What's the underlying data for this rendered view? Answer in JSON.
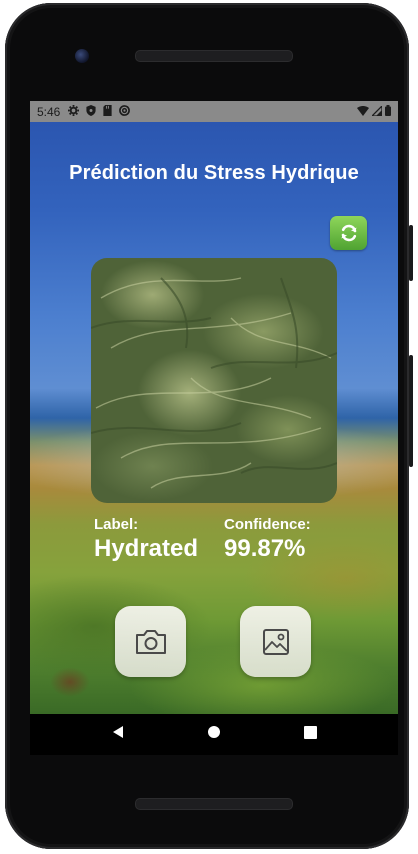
{
  "status_bar": {
    "time": "5:46",
    "left_icons": [
      "gear-icon",
      "shield-icon",
      "sd-card-icon",
      "at-sign-icon"
    ],
    "right_icons": [
      "wifi-icon",
      "signal-icon",
      "battery-icon"
    ]
  },
  "app": {
    "title": "Prédiction du Stress Hydrique",
    "refresh_icon": "refresh-icon",
    "image_alt_icon": "leaf-photo",
    "result": {
      "label_caption": "Label:",
      "label_value": "Hydrated",
      "confidence_caption": "Confidence:",
      "confidence_value": "99.87%"
    },
    "buttons": {
      "camera_icon": "camera-icon",
      "gallery_icon": "image-icon"
    },
    "colors": {
      "refresh_button": "#5fb83f",
      "title_text": "#ffffff",
      "action_button_bg": "#f0f0e8"
    }
  },
  "nav_bar": {
    "icons": [
      "back-icon",
      "home-icon",
      "recents-icon"
    ]
  }
}
